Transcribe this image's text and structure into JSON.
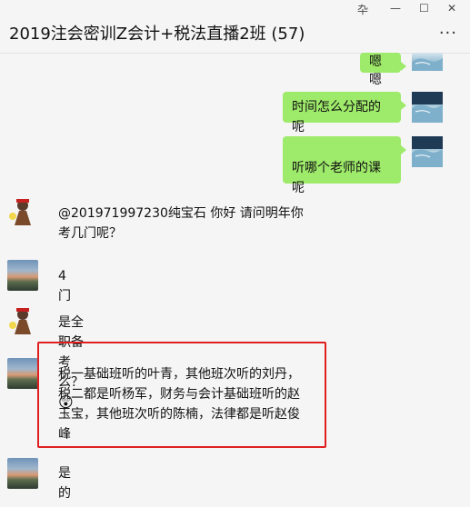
{
  "window": {
    "title": "2019注会密训Z会计+税法直播2班 (57)",
    "controls": {
      "pin": "卆",
      "minimize": "—",
      "maximize": "☐",
      "close": "✕"
    },
    "more": "···"
  },
  "messages": [
    {
      "side": "right",
      "text": "嗯嗯"
    },
    {
      "side": "right",
      "text": "时间怎么分配的呢"
    },
    {
      "side": "right",
      "text": "听哪个老师的课呢"
    },
    {
      "side": "left",
      "line1": "@201971997230纯宝石 你好 请问明年你",
      "line2": "考几门呢？"
    },
    {
      "side": "left",
      "text": "4门"
    },
    {
      "side": "left",
      "text": "是全职备考么？",
      "emoji": "😲"
    },
    {
      "side": "left",
      "lines": [
        "税一基础班听的叶青，其他班次听的刘丹，",
        "税二都是听杨军，财务与会计基础班听的赵",
        "玉宝，其他班次听的陈楠，法律都是听赵俊",
        "峰"
      ]
    },
    {
      "side": "left",
      "text": "是的"
    }
  ]
}
